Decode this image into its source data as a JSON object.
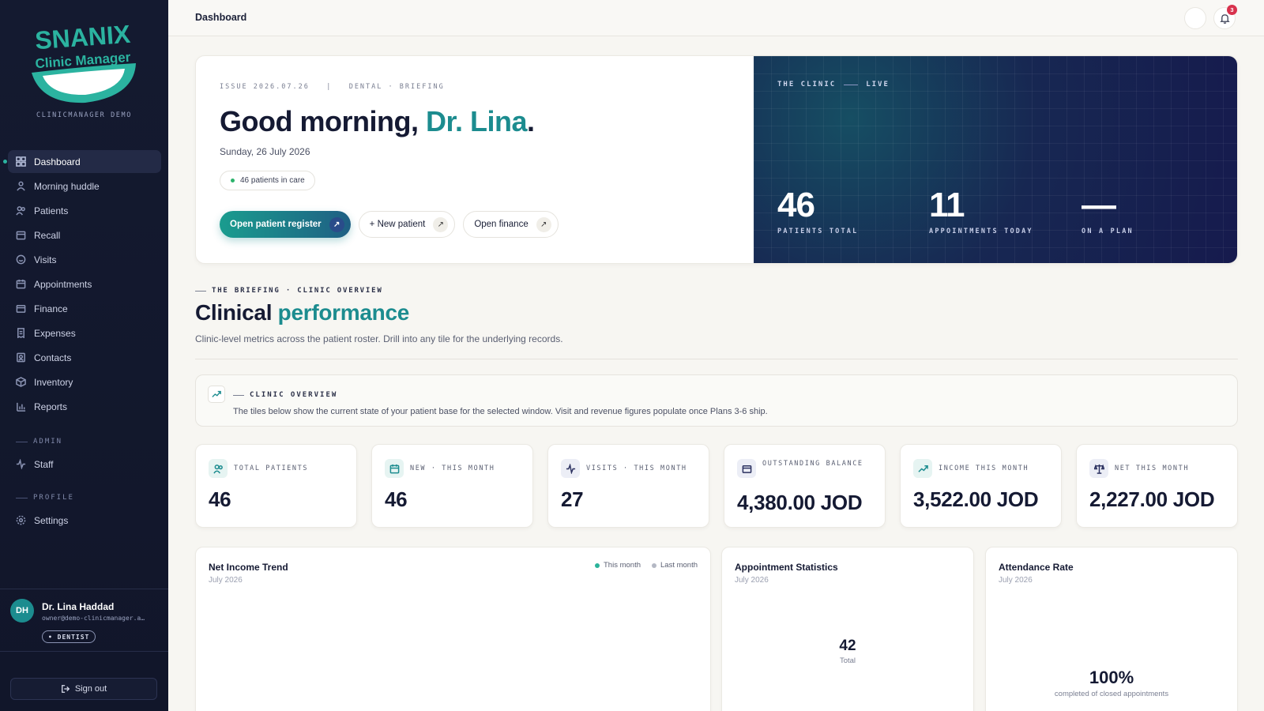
{
  "brand": {
    "name": "SNANIX",
    "tagline": "Clinic Manager",
    "subtitle": "CLINICMANAGER DEMO",
    "color_teal": "#1c8c8f",
    "color_navy": "#141a30"
  },
  "nav": {
    "items": [
      {
        "label": "Dashboard",
        "icon": "grid-icon",
        "active": true
      },
      {
        "label": "Morning huddle",
        "icon": "huddle-icon"
      },
      {
        "label": "Patients",
        "icon": "users-icon"
      },
      {
        "label": "Recall",
        "icon": "calendar-recall-icon"
      },
      {
        "label": "Visits",
        "icon": "visit-icon"
      },
      {
        "label": "Appointments",
        "icon": "calendar-icon"
      },
      {
        "label": "Finance",
        "icon": "wallet-icon"
      },
      {
        "label": "Expenses",
        "icon": "receipt-icon"
      },
      {
        "label": "Contacts",
        "icon": "contacts-icon"
      },
      {
        "label": "Inventory",
        "icon": "box-icon"
      },
      {
        "label": "Reports",
        "icon": "bar-chart-icon"
      }
    ],
    "admin_label": "ADMIN",
    "admin_items": [
      {
        "label": "Staff",
        "icon": "activity-icon"
      }
    ],
    "profile_label": "PROFILE",
    "profile_items": [
      {
        "label": "Settings",
        "icon": "gear-icon"
      }
    ]
  },
  "user": {
    "initials": "DH",
    "name": "Dr. Lina Haddad",
    "email": "owner@demo-clinicmanager.a…",
    "role": "• DENTIST"
  },
  "sign_out": "Sign out",
  "topbar": {
    "title": "Dashboard",
    "notification_count": "3"
  },
  "hero": {
    "issue": "ISSUE 2026.07.26   |   DENTAL · BRIEFING",
    "greeting_prefix": "Good morning, ",
    "greeting_name": "Dr. Lina",
    "greeting_suffix": ".",
    "date": "Sunday, 26 July 2026",
    "pill": "46 patients in care",
    "buttons": {
      "register": "Open patient register",
      "new_patient": "+ New patient",
      "finance": "Open finance"
    },
    "live": {
      "tag_left": "THE CLINIC",
      "tag_right": "LIVE",
      "stats": [
        {
          "value": "46",
          "label": "PATIENTS TOTAL"
        },
        {
          "value": "11",
          "label": "APPOINTMENTS TODAY"
        },
        {
          "value": "—",
          "label": "ON A PLAN"
        }
      ]
    }
  },
  "briefing": {
    "kicker": "THE BRIEFING · CLINIC OVERVIEW",
    "title_prefix": "Clinical ",
    "title_highlight": "performance",
    "subtitle": "Clinic-level metrics across the patient roster. Drill into any tile for the underlying records."
  },
  "overview": {
    "tag": "CLINIC OVERVIEW",
    "description": "The tiles below show the current state of your patient base for the selected window. Visit and revenue figures populate once Plans 3-6 ship."
  },
  "kpis": [
    {
      "label": "TOTAL PATIENTS",
      "value": "46",
      "icon": "users-icon",
      "color": "#1c8c8f",
      "bg": "#e6f4f2"
    },
    {
      "label": "NEW · THIS MONTH",
      "value": "46",
      "icon": "calendar-icon",
      "color": "#1c8c8f",
      "bg": "#e6f4f2"
    },
    {
      "label": "VISITS · THIS MONTH",
      "value": "27",
      "icon": "activity-icon",
      "color": "#2b3160",
      "bg": "#eceef6"
    },
    {
      "label": "OUTSTANDING BALANCE",
      "value": "4,380.00 JOD",
      "icon": "wallet-icon",
      "color": "#2b3160",
      "bg": "#eceef6"
    },
    {
      "label": "INCOME THIS MONTH",
      "value": "3,522.00 JOD",
      "icon": "trend-up-icon",
      "color": "#1c8c8f",
      "bg": "#e6f4f2"
    },
    {
      "label": "NET THIS MONTH",
      "value": "2,227.00 JOD",
      "icon": "scale-icon",
      "color": "#2b3160",
      "bg": "#eceef6"
    }
  ],
  "cards": {
    "income": {
      "title": "Net Income Trend",
      "period": "July 2026",
      "legend_this": "This month",
      "legend_last": "Last month",
      "color_this": "#2bb39a",
      "color_last": "#b4b8c4"
    },
    "appointments": {
      "title": "Appointment Statistics",
      "period": "July 2026",
      "total": "42",
      "total_label": "Total"
    },
    "attendance": {
      "title": "Attendance Rate",
      "period": "July 2026",
      "rate": "100%",
      "rate_label": "completed of closed appointments"
    }
  }
}
